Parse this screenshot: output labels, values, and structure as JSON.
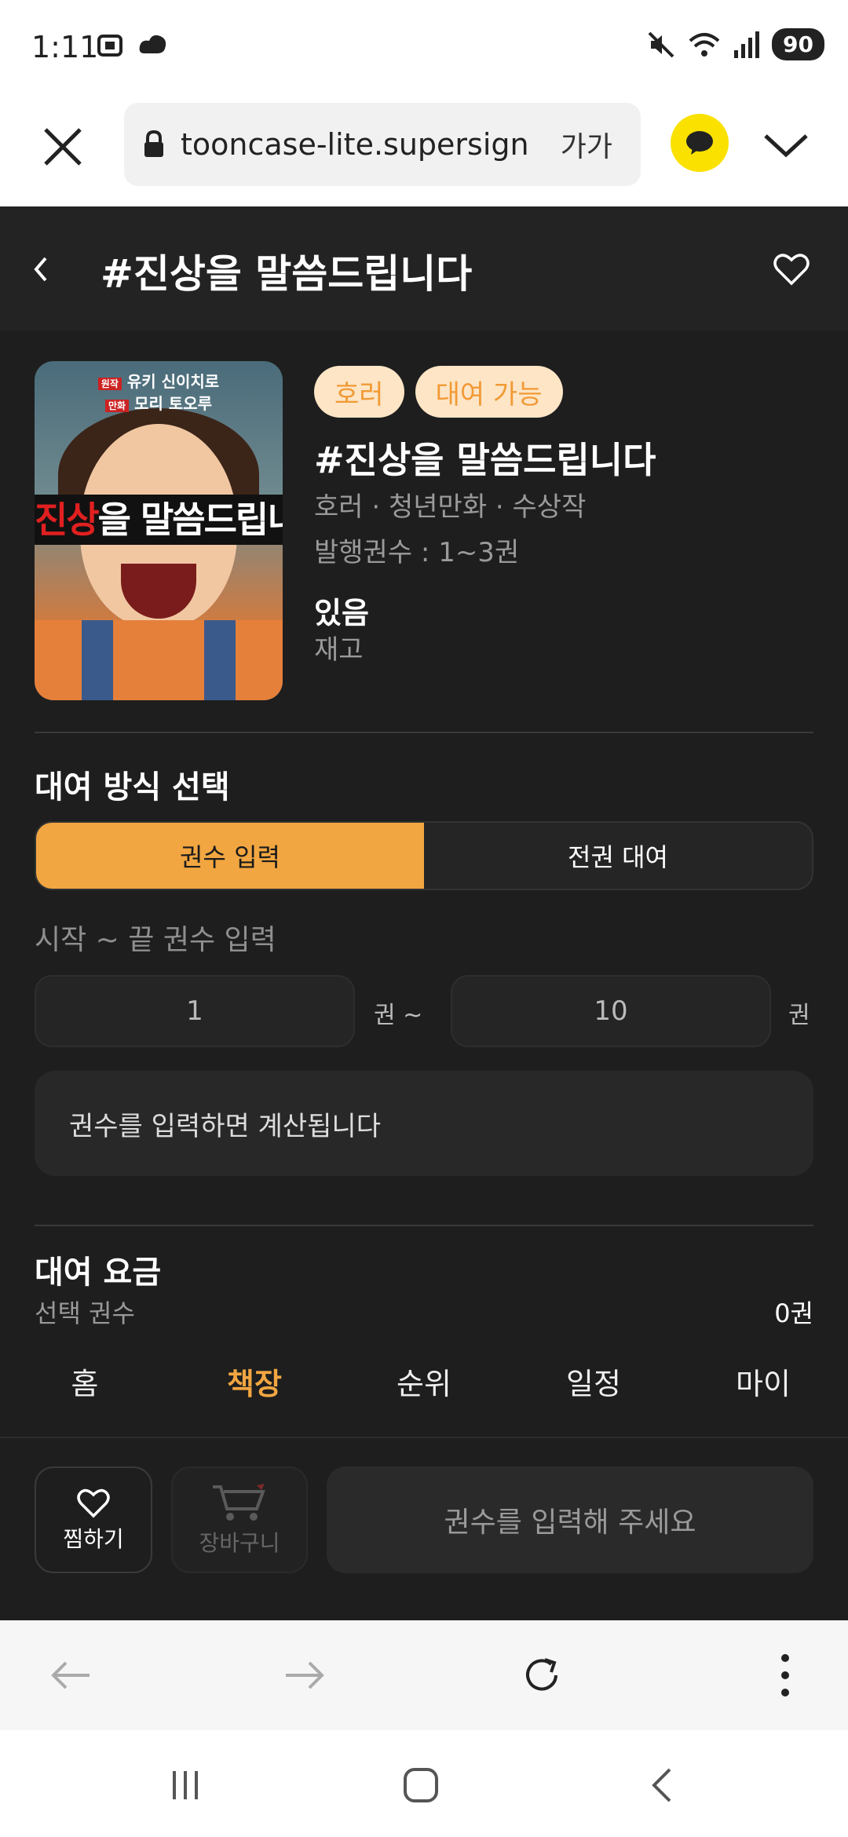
{
  "status_bar": {
    "time": "1:11",
    "battery": "90"
  },
  "browser": {
    "url": "tooncase-lite.supersign",
    "text_size": "가가"
  },
  "header": {
    "title": "#진상을 말씀드립니다"
  },
  "cover": {
    "credit_1_tag": "원작",
    "credit_1": "유키 신이치로",
    "credit_2_tag": "만화",
    "credit_2": "모리 토오루",
    "title_red": "진상",
    "title_rest": "을 말씀드립니"
  },
  "product": {
    "badges": [
      "호러",
      "대여 가능"
    ],
    "title": "#진상을 말씀드립니다",
    "genre": "호러 · 청년만화 · 수상작",
    "issued": "발행권수 : 1~3권",
    "stock_value": "있음",
    "stock_label": "재고"
  },
  "rental_mode": {
    "title": "대여 방식 선택",
    "options": [
      "권수 입력",
      "전권 대여"
    ],
    "selected": "권수 입력"
  },
  "volume_range": {
    "label": "시작 ~ 끝 권수 입력",
    "start": "1",
    "end": "10",
    "unit": "권",
    "separator": "권 ~",
    "calc_message": "권수를 입력하면 계산됩니다"
  },
  "fee": {
    "title": "대여 요금",
    "selected_label": "선택 권수",
    "selected_value": "0권"
  },
  "tabs": {
    "items": [
      "홈",
      "책장",
      "순위",
      "일정",
      "마이"
    ],
    "active": "책장"
  },
  "actions": {
    "wish": "찜하기",
    "cart": "장바구니",
    "cta": "권수를 입력해 주세요"
  },
  "colors": {
    "accent": "#f2a641",
    "background": "#1e1e1e",
    "badge_bg": "#fde5c6"
  }
}
